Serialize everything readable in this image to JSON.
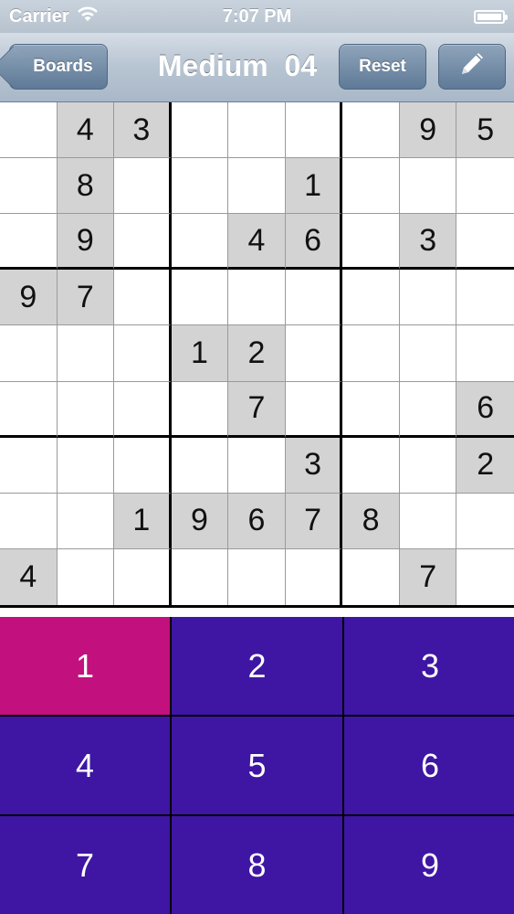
{
  "status_bar": {
    "carrier": "Carrier",
    "time": "7:07 PM",
    "wifi_icon": "wifi-icon",
    "battery_icon": "battery-icon"
  },
  "nav": {
    "back_label": "Boards",
    "title": "Medium  04",
    "reset_label": "Reset",
    "edit_icon": "pencil-icon"
  },
  "board": {
    "rows": [
      [
        "",
        "4",
        "3",
        "",
        "",
        "",
        "",
        "9",
        "5"
      ],
      [
        "",
        "8",
        "",
        "",
        "",
        "1",
        "",
        "",
        ""
      ],
      [
        "",
        "9",
        "",
        "",
        "4",
        "6",
        "",
        "3",
        ""
      ],
      [
        "9",
        "7",
        "",
        "",
        "",
        "",
        "",
        "",
        ""
      ],
      [
        "",
        "",
        "",
        "1",
        "2",
        "",
        "",
        "",
        ""
      ],
      [
        "",
        "",
        "",
        "",
        "7",
        "",
        "",
        "",
        "6"
      ],
      [
        "",
        "",
        "",
        "",
        "",
        "3",
        "",
        "",
        "2"
      ],
      [
        "",
        "",
        "1",
        "9",
        "6",
        "7",
        "8",
        "",
        ""
      ],
      [
        "4",
        "",
        "",
        "",
        "",
        "",
        "",
        "7",
        ""
      ]
    ],
    "given_color": "#d3d3d3"
  },
  "keypad": {
    "keys": [
      "1",
      "2",
      "3",
      "4",
      "5",
      "6",
      "7",
      "8",
      "9"
    ],
    "selected": "1",
    "key_color": "#3e16a3",
    "selected_color": "#c2117e"
  }
}
